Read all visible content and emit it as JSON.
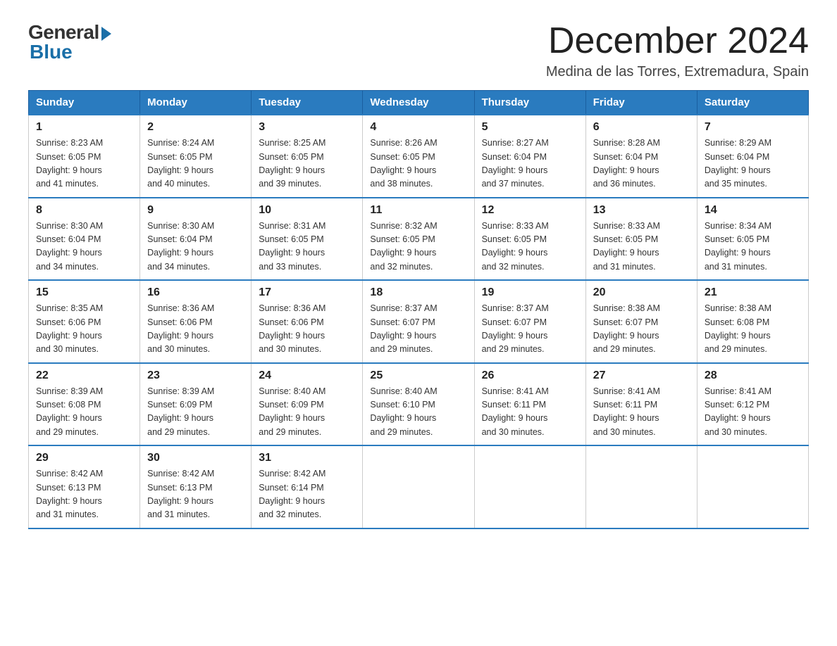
{
  "logo": {
    "general": "General",
    "blue": "Blue"
  },
  "title": "December 2024",
  "location": "Medina de las Torres, Extremadura, Spain",
  "headers": [
    "Sunday",
    "Monday",
    "Tuesday",
    "Wednesday",
    "Thursday",
    "Friday",
    "Saturday"
  ],
  "weeks": [
    [
      {
        "day": "1",
        "sunrise": "8:23 AM",
        "sunset": "6:05 PM",
        "daylight": "9 hours and 41 minutes."
      },
      {
        "day": "2",
        "sunrise": "8:24 AM",
        "sunset": "6:05 PM",
        "daylight": "9 hours and 40 minutes."
      },
      {
        "day": "3",
        "sunrise": "8:25 AM",
        "sunset": "6:05 PM",
        "daylight": "9 hours and 39 minutes."
      },
      {
        "day": "4",
        "sunrise": "8:26 AM",
        "sunset": "6:05 PM",
        "daylight": "9 hours and 38 minutes."
      },
      {
        "day": "5",
        "sunrise": "8:27 AM",
        "sunset": "6:04 PM",
        "daylight": "9 hours and 37 minutes."
      },
      {
        "day": "6",
        "sunrise": "8:28 AM",
        "sunset": "6:04 PM",
        "daylight": "9 hours and 36 minutes."
      },
      {
        "day": "7",
        "sunrise": "8:29 AM",
        "sunset": "6:04 PM",
        "daylight": "9 hours and 35 minutes."
      }
    ],
    [
      {
        "day": "8",
        "sunrise": "8:30 AM",
        "sunset": "6:04 PM",
        "daylight": "9 hours and 34 minutes."
      },
      {
        "day": "9",
        "sunrise": "8:30 AM",
        "sunset": "6:04 PM",
        "daylight": "9 hours and 34 minutes."
      },
      {
        "day": "10",
        "sunrise": "8:31 AM",
        "sunset": "6:05 PM",
        "daylight": "9 hours and 33 minutes."
      },
      {
        "day": "11",
        "sunrise": "8:32 AM",
        "sunset": "6:05 PM",
        "daylight": "9 hours and 32 minutes."
      },
      {
        "day": "12",
        "sunrise": "8:33 AM",
        "sunset": "6:05 PM",
        "daylight": "9 hours and 32 minutes."
      },
      {
        "day": "13",
        "sunrise": "8:33 AM",
        "sunset": "6:05 PM",
        "daylight": "9 hours and 31 minutes."
      },
      {
        "day": "14",
        "sunrise": "8:34 AM",
        "sunset": "6:05 PM",
        "daylight": "9 hours and 31 minutes."
      }
    ],
    [
      {
        "day": "15",
        "sunrise": "8:35 AM",
        "sunset": "6:06 PM",
        "daylight": "9 hours and 30 minutes."
      },
      {
        "day": "16",
        "sunrise": "8:36 AM",
        "sunset": "6:06 PM",
        "daylight": "9 hours and 30 minutes."
      },
      {
        "day": "17",
        "sunrise": "8:36 AM",
        "sunset": "6:06 PM",
        "daylight": "9 hours and 30 minutes."
      },
      {
        "day": "18",
        "sunrise": "8:37 AM",
        "sunset": "6:07 PM",
        "daylight": "9 hours and 29 minutes."
      },
      {
        "day": "19",
        "sunrise": "8:37 AM",
        "sunset": "6:07 PM",
        "daylight": "9 hours and 29 minutes."
      },
      {
        "day": "20",
        "sunrise": "8:38 AM",
        "sunset": "6:07 PM",
        "daylight": "9 hours and 29 minutes."
      },
      {
        "day": "21",
        "sunrise": "8:38 AM",
        "sunset": "6:08 PM",
        "daylight": "9 hours and 29 minutes."
      }
    ],
    [
      {
        "day": "22",
        "sunrise": "8:39 AM",
        "sunset": "6:08 PM",
        "daylight": "9 hours and 29 minutes."
      },
      {
        "day": "23",
        "sunrise": "8:39 AM",
        "sunset": "6:09 PM",
        "daylight": "9 hours and 29 minutes."
      },
      {
        "day": "24",
        "sunrise": "8:40 AM",
        "sunset": "6:09 PM",
        "daylight": "9 hours and 29 minutes."
      },
      {
        "day": "25",
        "sunrise": "8:40 AM",
        "sunset": "6:10 PM",
        "daylight": "9 hours and 29 minutes."
      },
      {
        "day": "26",
        "sunrise": "8:41 AM",
        "sunset": "6:11 PM",
        "daylight": "9 hours and 30 minutes."
      },
      {
        "day": "27",
        "sunrise": "8:41 AM",
        "sunset": "6:11 PM",
        "daylight": "9 hours and 30 minutes."
      },
      {
        "day": "28",
        "sunrise": "8:41 AM",
        "sunset": "6:12 PM",
        "daylight": "9 hours and 30 minutes."
      }
    ],
    [
      {
        "day": "29",
        "sunrise": "8:42 AM",
        "sunset": "6:13 PM",
        "daylight": "9 hours and 31 minutes."
      },
      {
        "day": "30",
        "sunrise": "8:42 AM",
        "sunset": "6:13 PM",
        "daylight": "9 hours and 31 minutes."
      },
      {
        "day": "31",
        "sunrise": "8:42 AM",
        "sunset": "6:14 PM",
        "daylight": "9 hours and 32 minutes."
      },
      null,
      null,
      null,
      null
    ]
  ],
  "labels": {
    "sunrise": "Sunrise:",
    "sunset": "Sunset:",
    "daylight": "Daylight: 9 hours"
  }
}
